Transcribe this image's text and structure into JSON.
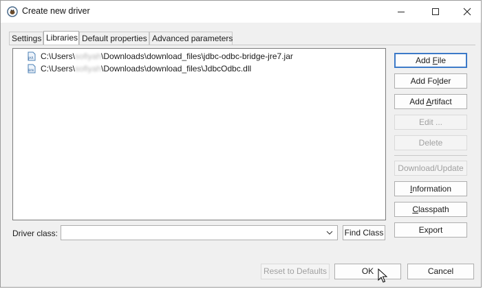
{
  "window": {
    "title": "Create new driver"
  },
  "tabs": [
    {
      "label": "Settings",
      "active": false
    },
    {
      "label": "Libraries",
      "active": true
    },
    {
      "label": "Default properties",
      "active": false
    },
    {
      "label": "Advanced parameters",
      "active": false
    }
  ],
  "libraries": [
    {
      "icon": "jar-file-icon",
      "icon_text": "JAR",
      "prefix": "C:\\Users\\",
      "redacted": "sofiyah",
      "suffix": "\\Downloads\\download_files\\jdbc-odbc-bridge-jre7.jar"
    },
    {
      "icon": "binary-file-icon",
      "icon_text": "BIN",
      "prefix": "C:\\Users\\",
      "redacted": "sofiyah",
      "suffix": "\\Downloads\\download_files\\JdbcOdbc.dll"
    }
  ],
  "buttons": {
    "add_file_pre": "Add ",
    "add_file_u": "F",
    "add_file_post": "ile",
    "add_folder_pre": "Add Fo",
    "add_folder_u": "l",
    "add_folder_post": "der",
    "add_artifact_pre": "Add ",
    "add_artifact_u": "A",
    "add_artifact_post": "rtifact",
    "edit": "Edit ...",
    "delete": "Delete",
    "download_update": "Download/Update",
    "information_u": "I",
    "information_post": "nformation",
    "classpath_u": "C",
    "classpath_post": "lasspath",
    "export": "Export",
    "find_class": "Find Class",
    "reset": "Reset to Defaults",
    "ok": "OK",
    "cancel": "Cancel"
  },
  "driver_class": {
    "label": "Driver class:",
    "value": ""
  },
  "colors": {
    "accent": "#3b79c8",
    "disabled_text": "#a0a0a0"
  }
}
